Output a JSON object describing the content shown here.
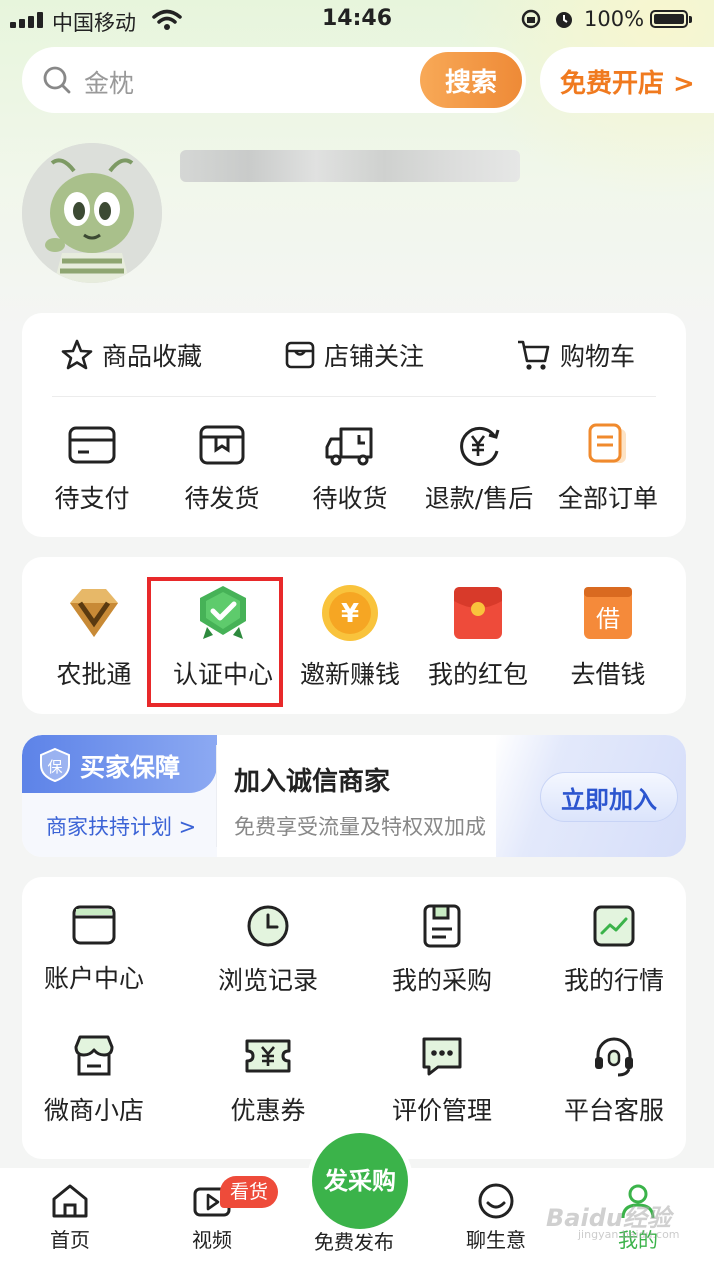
{
  "status_bar": {
    "carrier": "中国移动",
    "time": "14:46",
    "battery": "100%"
  },
  "search": {
    "placeholder": "金枕",
    "button": "搜索"
  },
  "open_store": "免费开店 >",
  "quick_links": [
    "商品收藏",
    "店铺关注",
    "购物车"
  ],
  "orders": [
    "待支付",
    "待发货",
    "待收货",
    "退款/售后",
    "全部订单"
  ],
  "services": [
    "农批通",
    "认证中心",
    "邀新赚钱",
    "我的红包",
    "去借钱"
  ],
  "service_icons": {
    "coin_char": "¥",
    "loan_char": "借"
  },
  "banner": {
    "badge_label": "买家保障",
    "badge_icon_char": "保",
    "sub_link": "商家扶持计划 >",
    "title": "加入诚信商家",
    "subtitle": "免费享受流量及特权双加成",
    "button": "立即加入"
  },
  "tools": [
    "账户中心",
    "浏览记录",
    "我的采购",
    "我的行情",
    "微商小店",
    "优惠券",
    "评价管理",
    "平台客服"
  ],
  "tabbar": {
    "items": [
      "首页",
      "视频",
      "免费发布",
      "聊生意",
      "我的"
    ],
    "publish_label": "发采购",
    "video_badge": "看货"
  },
  "watermark": {
    "main": "Baidu经验",
    "sub": "jingyan.baidu.com"
  },
  "colors": {
    "accent_green": "#3bb34a",
    "orange": "#f07a1f",
    "highlight_red": "#e8292a",
    "blue": "#2c55cf"
  }
}
